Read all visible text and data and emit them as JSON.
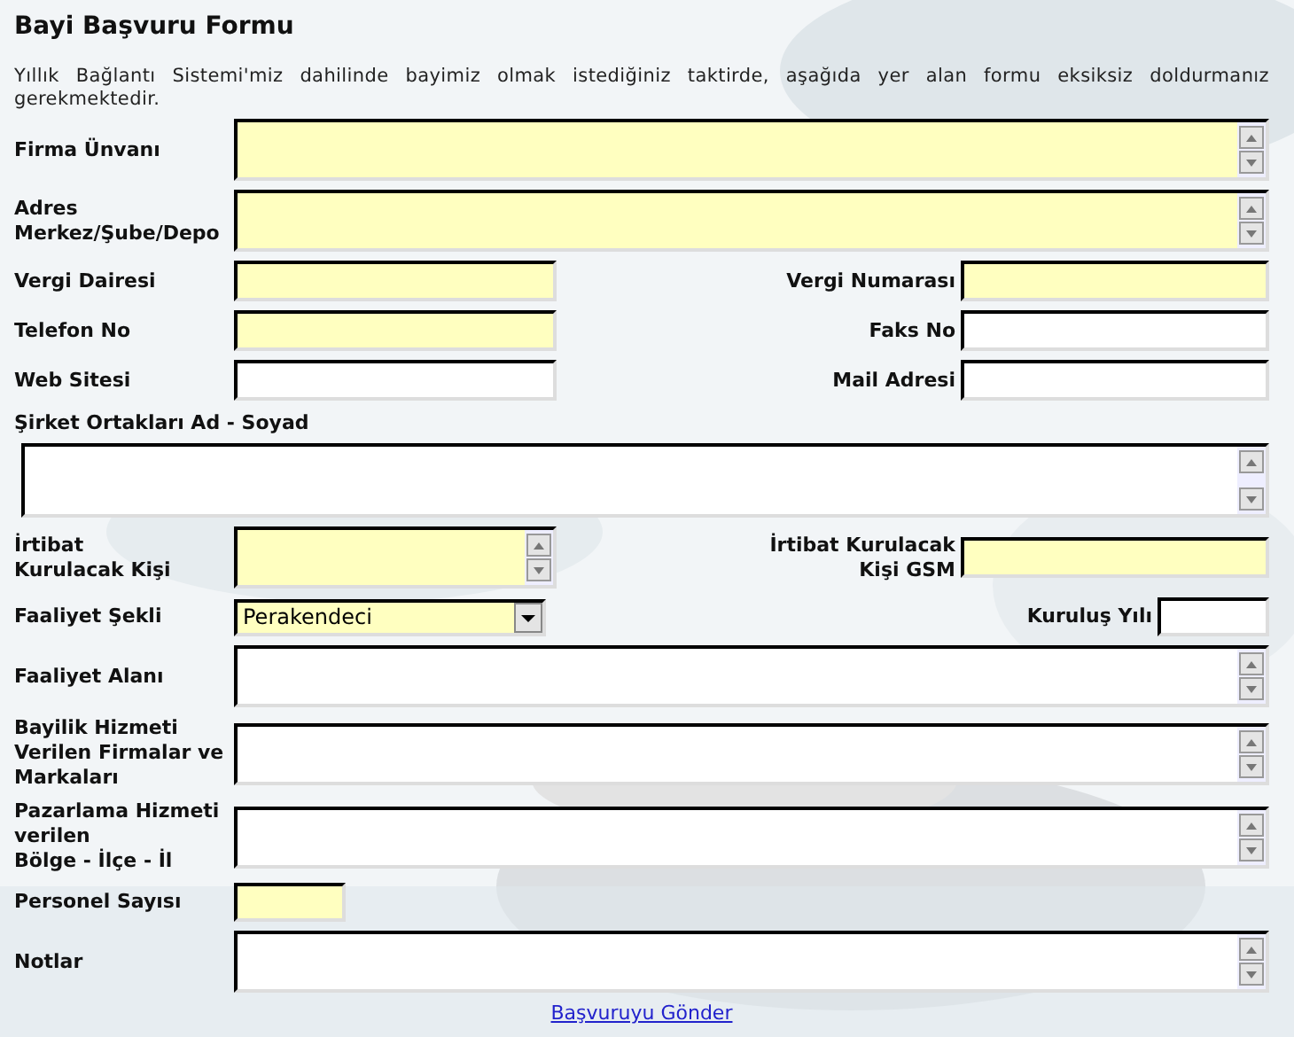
{
  "title": "Bayi Başvuru Formu",
  "intro": "Yıllık Bağlantı Sistemi'miz dahilinde bayimiz olmak istediğiniz taktirde, aşağıda yer alan formu eksiksiz doldurmanız gerekmektedir.",
  "rows": [
    {
      "kind": "wide",
      "fields": [
        {
          "label": "Firma Ünvanı",
          "kind": "textarea",
          "required": true
        }
      ]
    },
    {
      "kind": "wide",
      "fields": [
        {
          "label": "Adres\nMerkez/Şube/Depo",
          "kind": "textarea",
          "required": true
        }
      ]
    },
    {
      "kind": "pair",
      "fields": [
        {
          "label": "Vergi Dairesi",
          "kind": "input",
          "required": true
        },
        {
          "label": "Vergi Numarası",
          "kind": "input",
          "required": true
        }
      ]
    },
    {
      "kind": "pair",
      "fields": [
        {
          "label": "Telefon No",
          "kind": "input",
          "required": true
        },
        {
          "label": "Faks No",
          "kind": "input",
          "required": false
        }
      ]
    },
    {
      "kind": "pair",
      "fields": [
        {
          "label": "Web Sitesi",
          "kind": "input",
          "required": false
        },
        {
          "label": "Mail Adresi",
          "kind": "input",
          "required": false
        }
      ]
    },
    {
      "kind": "stacked",
      "fields": [
        {
          "label": "Şirket Ortakları Ad - Soyad",
          "kind": "textarea",
          "required": false
        }
      ]
    },
    {
      "kind": "pair",
      "fields": [
        {
          "label": "İrtibat\nKurulacak Kişi",
          "kind": "textarea",
          "required": true
        },
        {
          "label": "İrtibat Kurulacak\nKişi GSM",
          "kind": "input",
          "required": true
        }
      ]
    },
    {
      "kind": "pair",
      "fields": [
        {
          "label": "Faaliyet Şekli",
          "kind": "select",
          "required": true,
          "value": "Perakendeci"
        },
        {
          "label": "Kuruluş Yılı",
          "kind": "short",
          "required": false
        }
      ]
    },
    {
      "kind": "wide",
      "fields": [
        {
          "label": "Faaliyet Alanı",
          "kind": "textarea",
          "required": false
        }
      ]
    },
    {
      "kind": "wide",
      "fields": [
        {
          "label": "Bayilik Hizmeti\nVerilen Firmalar ve\nMarkaları",
          "kind": "textarea",
          "required": false
        }
      ]
    },
    {
      "kind": "wide",
      "fields": [
        {
          "label": "Pazarlama Hizmeti\nverilen\nBölge - İlçe - İl",
          "kind": "textarea",
          "required": false
        }
      ]
    },
    {
      "kind": "wide",
      "fields": [
        {
          "label": "Personel Sayısı",
          "kind": "short",
          "required": true
        }
      ]
    },
    {
      "kind": "wide",
      "fields": [
        {
          "label": "Notlar",
          "kind": "textarea",
          "required": false
        }
      ]
    }
  ],
  "submit": "Başvuruyu Gönder"
}
